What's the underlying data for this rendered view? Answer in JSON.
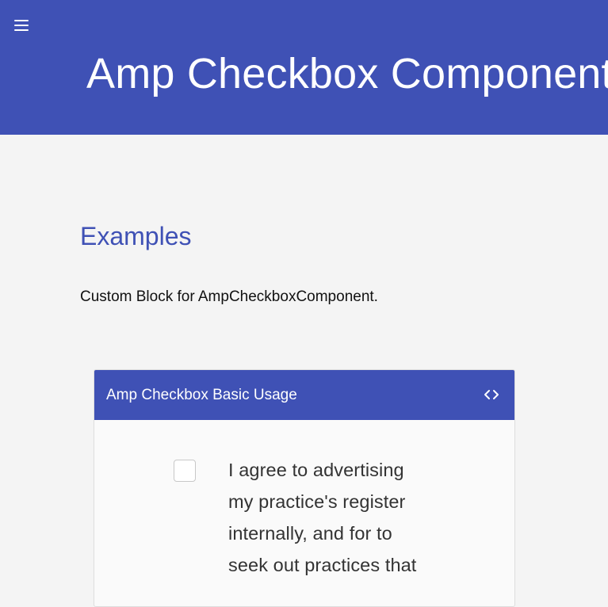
{
  "theme": {
    "brand_color": "#3f51b5",
    "background_color": "#f4f4f4"
  },
  "header": {
    "menu_icon": "menu-icon",
    "title": "Amp Checkbox Component"
  },
  "section": {
    "title": "Examples",
    "description": "Custom Block for AmpCheckboxComponent."
  },
  "card": {
    "title": "Amp Checkbox Basic Usage",
    "code_icon": "code-icon",
    "checkbox": {
      "checked": false,
      "label": "I agree to advertising my practice's register internally, and for to seek out practices that"
    }
  }
}
